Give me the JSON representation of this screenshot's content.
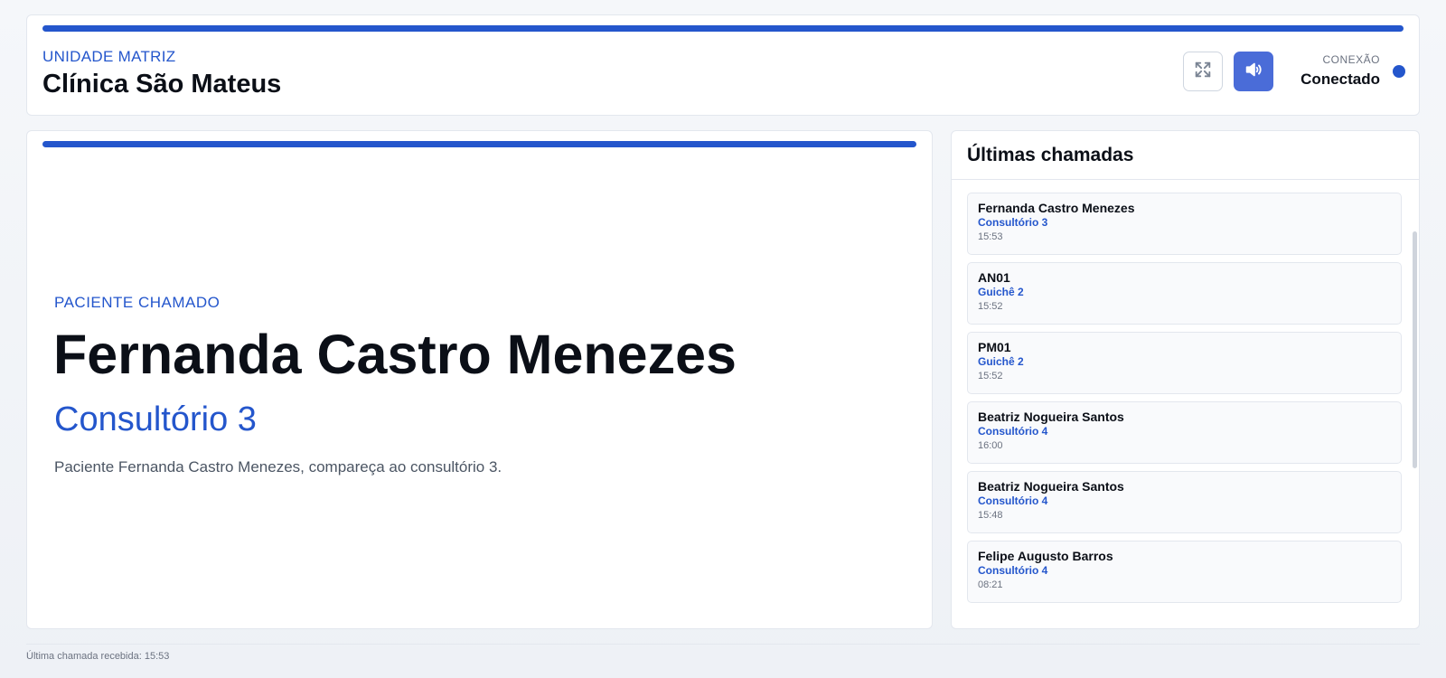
{
  "header": {
    "unit_label": "UNIDADE MATRIZ",
    "clinic_name": "Clínica São Mateus",
    "fullscreen_icon": "expand-icon",
    "sound_icon": "speaker-icon",
    "connection_label": "CONEXÃO",
    "connection_status": "Conectado"
  },
  "current_call": {
    "label": "PACIENTE CHAMADO",
    "patient_name": "Fernanda Castro Menezes",
    "room": "Consultório 3",
    "message": "Paciente Fernanda Castro Menezes, compareça ao consultório 3."
  },
  "recent_calls": {
    "title": "Últimas chamadas",
    "items": [
      {
        "name": "Fernanda Castro Menezes",
        "room": "Consultório 3",
        "time": "15:53"
      },
      {
        "name": "AN01",
        "room": "Guichê 2",
        "time": "15:52"
      },
      {
        "name": "PM01",
        "room": "Guichê 2",
        "time": "15:52"
      },
      {
        "name": "Beatriz Nogueira Santos",
        "room": "Consultório 4",
        "time": "16:00"
      },
      {
        "name": "Beatriz Nogueira Santos",
        "room": "Consultório 4",
        "time": "15:48"
      },
      {
        "name": "Felipe Augusto Barros",
        "room": "Consultório 4",
        "time": "08:21"
      }
    ]
  },
  "footer": {
    "last_call_text": "Última chamada recebida: 15:53"
  },
  "colors": {
    "accent": "#2456cc",
    "sound_button": "#4a6cd8",
    "connected_dot": "#2456cc"
  }
}
